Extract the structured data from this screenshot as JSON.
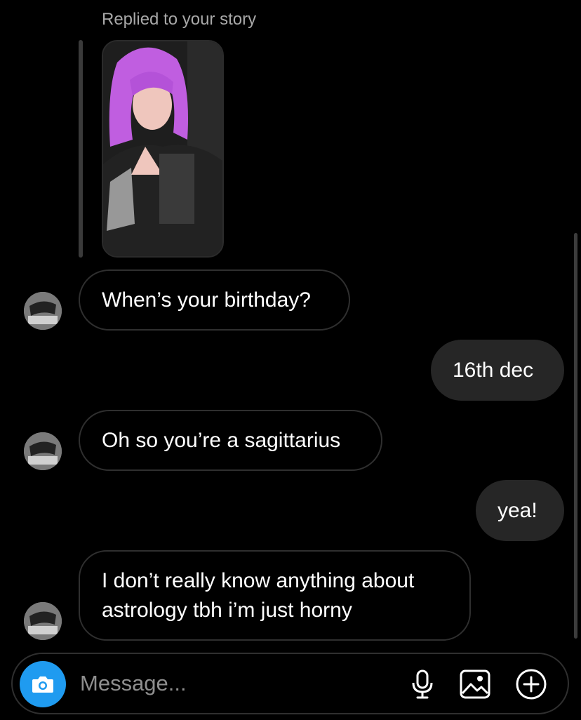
{
  "story_reply": {
    "label": "Replied to your story"
  },
  "messages": [
    {
      "direction": "incoming",
      "text": "When’s your birthday?"
    },
    {
      "direction": "outgoing",
      "text": "16th dec"
    },
    {
      "direction": "incoming",
      "text": "Oh so you’re a sagittarius"
    },
    {
      "direction": "outgoing",
      "text": "yea!"
    },
    {
      "direction": "incoming",
      "text": "I don’t really know anything about astrology tbh i’m just horny"
    }
  ],
  "composer": {
    "placeholder": "Message...",
    "icons": [
      "camera-icon",
      "microphone-icon",
      "gallery-icon",
      "add-icon"
    ]
  },
  "colors": {
    "background": "#000000",
    "incoming_border": "#2f2f2f",
    "outgoing_fill": "#262626",
    "camera_accent": "#1f9bf0",
    "secondary_text": "#a8a8a8"
  }
}
